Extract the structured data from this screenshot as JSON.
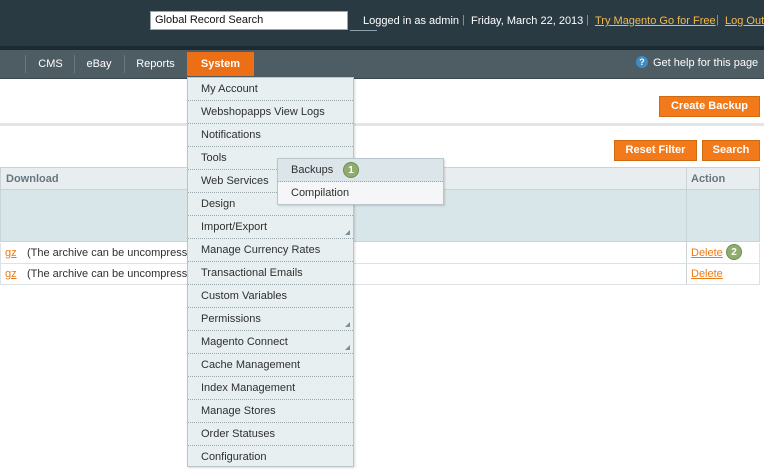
{
  "header": {
    "search_value": "Global Record Search",
    "logged_in": "Logged in as admin",
    "date": "Friday, March 22, 2013",
    "try_link": "Try Magento Go for Free",
    "logout": "Log Out",
    "separator": "|"
  },
  "nav": {
    "items": [
      "CMS",
      "eBay",
      "Reports"
    ],
    "active": "System",
    "help": "Get help for this page",
    "help_icon_glyph": "?"
  },
  "buttons": {
    "create_backup": "Create Backup",
    "reset_filter": "Reset Filter",
    "search": "Search"
  },
  "grid": {
    "headers": {
      "download": "Download",
      "action": "Action"
    },
    "rows": [
      {
        "link": "gz",
        "text": "(The archive can be uncompressed",
        "action": "Delete"
      },
      {
        "link": "gz",
        "text": "(The archive can be uncompressed",
        "action": "Delete"
      }
    ]
  },
  "menu": {
    "items": [
      "My Account",
      "Webshopapps View Logs",
      "Notifications",
      "Tools",
      "Web Services",
      "Design",
      "Import/Export",
      "Manage Currency Rates",
      "Transactional Emails",
      "Custom Variables",
      "Permissions",
      "Magento Connect",
      "Cache Management",
      "Index Management",
      "Manage Stores",
      "Order Statuses",
      "Configuration"
    ],
    "submenu": [
      "Backups",
      "Compilation"
    ]
  },
  "badges": [
    "1",
    "2"
  ],
  "colors": {
    "accent": "#ec6f15",
    "header_bg": "#2a3a43",
    "nav_bg": "#4e5d64",
    "link": "#eb7a17",
    "badge": "#8fae6d"
  }
}
